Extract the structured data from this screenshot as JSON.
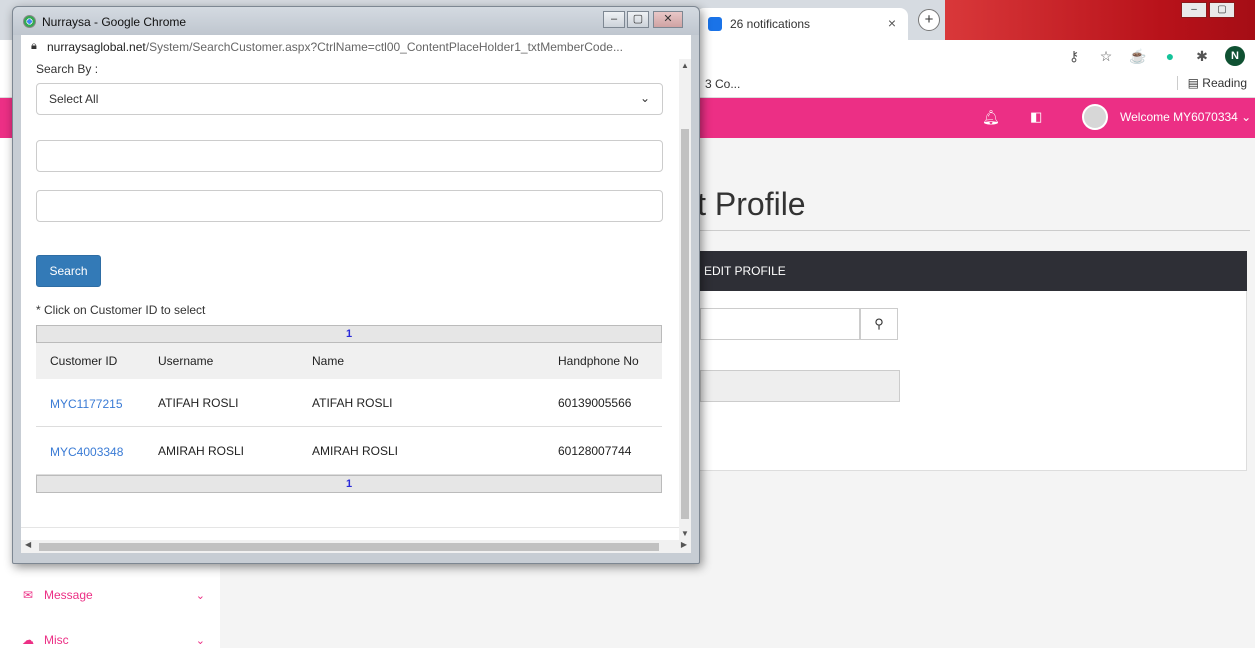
{
  "bg_browser": {
    "tab_title": "26 notifications",
    "tab_close": "×",
    "new_tab": "+",
    "bookmark_label": "3 Co...",
    "reading_list": "Reading",
    "profile_initial": "N"
  },
  "bg_page": {
    "welcome_text": "Welcome MY6070334 ⌄",
    "title": "it Profile",
    "panel_header": "EDIT PROFILE",
    "search_icon": "🔍",
    "sidebar": [
      {
        "label": "Message",
        "icon": "envelope-icon"
      },
      {
        "label": "Misc",
        "icon": "cloud-icon"
      }
    ]
  },
  "popup": {
    "window_title": "Nurraysa - Google Chrome",
    "url_host": "nurraysaglobal.net",
    "url_path": "/System/SearchCustomer.aspx?CtrlName=ctl00_ContentPlaceHolder1_txtMemberCode...",
    "search_by_label": "Search By :",
    "select_value": "Select All",
    "search_button": "Search",
    "hint": "* Click on Customer ID to select",
    "pager_top": "1",
    "pager_bottom": "1",
    "columns": [
      "Customer ID",
      "Username",
      "Name",
      "Handphone No"
    ],
    "rows": [
      {
        "id": "MYC1177215",
        "username": "ATIFAH ROSLI",
        "name": "ATIFAH ROSLI",
        "phone": "60139005566"
      },
      {
        "id": "MYC4003348",
        "username": "AMIRAH ROSLI",
        "name": "AMIRAH ROSLI",
        "phone": "60128007744"
      }
    ]
  }
}
